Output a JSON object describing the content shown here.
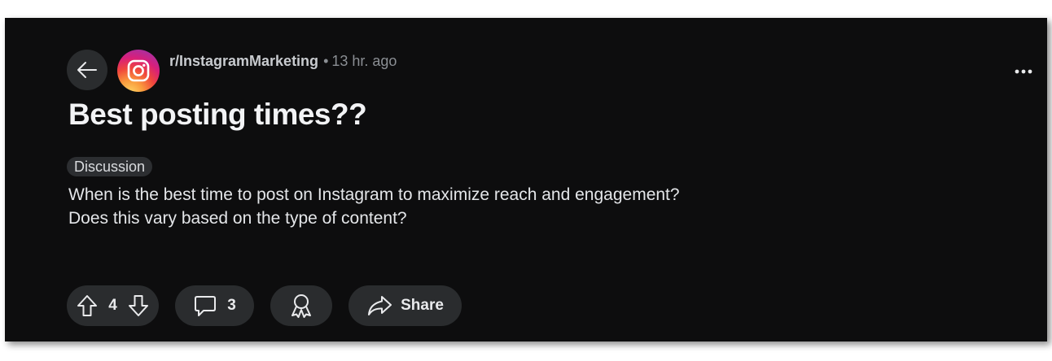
{
  "post": {
    "community": "r/InstagramMarketing",
    "separator": "•",
    "time": "13 hr. ago",
    "title": "Best posting times??",
    "flair": "Discussion",
    "body_line1": "When is the best time to post on Instagram to maximize reach and engagement?",
    "body_line2": "Does this vary based on the type of content?"
  },
  "actions": {
    "vote_count": "4",
    "comment_count": "3",
    "share_label": "Share"
  },
  "icons": {
    "back": "arrow-left-icon",
    "avatar": "instagram-logo",
    "more": "ellipsis-horizontal-icon",
    "upvote": "arrow-up-outline-icon",
    "downvote": "arrow-down-outline-icon",
    "comment": "speech-bubble-icon",
    "award": "award-ribbon-icon",
    "share": "share-arrow-icon"
  },
  "colors": {
    "background": "#0d0d0e",
    "pill": "#2a2c2e",
    "text": "#e9eaec",
    "muted": "#8b8f94"
  }
}
